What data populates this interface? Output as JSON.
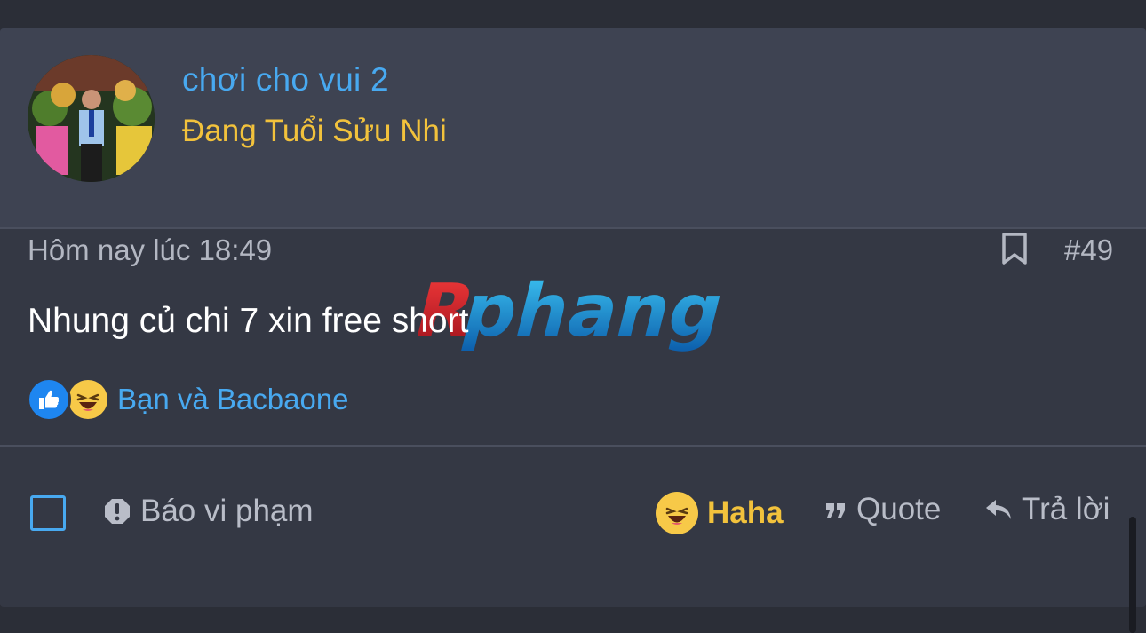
{
  "user": {
    "name": "chơi cho vui 2",
    "title": "Đang Tuổi Sửu Nhi"
  },
  "post": {
    "date": "Hôm nay lúc 18:49",
    "number": "#49",
    "body": "Nhung củ chi 7 xin free short",
    "reactions_text": "Bạn và Bacbaone",
    "reaction_icons": [
      "like-icon",
      "haha-icon"
    ]
  },
  "watermark": {
    "text": "Rphang"
  },
  "footer": {
    "report_label": "Báo vi phạm",
    "haha_label": "Haha",
    "quote_label": "Quote",
    "reply_label": "Trả lời"
  },
  "colors": {
    "link_blue": "#48a9f0",
    "user_title_gold": "#f2c23c",
    "post_bg": "#343844",
    "user_block_bg": "#3e4352"
  }
}
